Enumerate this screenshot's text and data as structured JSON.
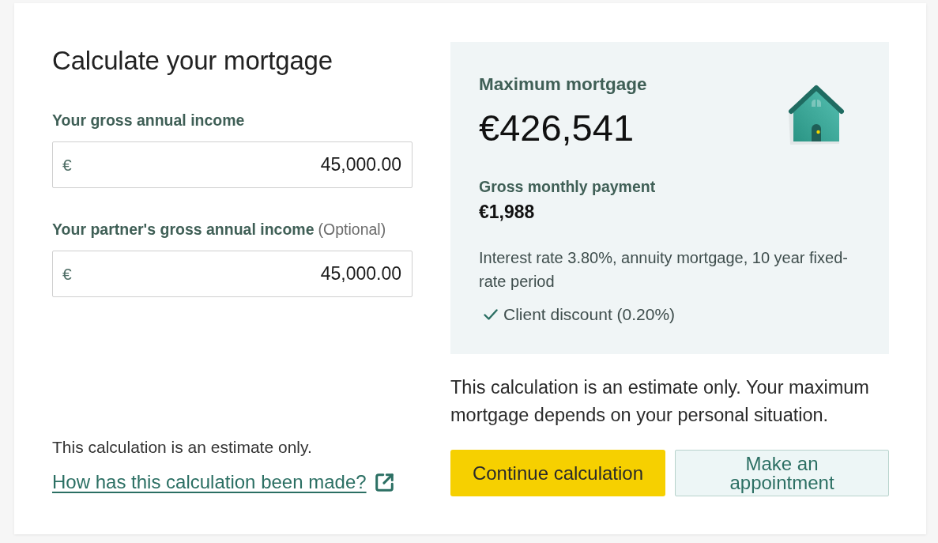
{
  "calculator": {
    "title": "Calculate your mortgage",
    "fields": [
      {
        "label": "Your gross annual income",
        "currency": "€",
        "value": "45,000.00"
      },
      {
        "label": "Your partner's gross annual income",
        "optional_note": "(Optional)",
        "currency": "€",
        "value": "45,000.00"
      }
    ],
    "disclaimer": "This calculation is an estimate only.",
    "info_link": "How has this calculation been made?"
  },
  "result": {
    "title": "Maximum mortgage",
    "amount": "€426,541",
    "monthly_label": "Gross monthly payment",
    "monthly_amount": "€1,988",
    "terms": "Interest rate 3.80%, annuity mortgage, 10 year fixed-rate period",
    "discount": {
      "label": "Client discount (0.20%)",
      "checked": true
    }
  },
  "note": "This calculation is an estimate only. Your maximum mortgage depends on your personal situation.",
  "buttons": [
    {
      "label": "Continue calculation",
      "kind": "primary"
    },
    {
      "label": "Make an appointment",
      "kind": "secondary"
    }
  ]
}
